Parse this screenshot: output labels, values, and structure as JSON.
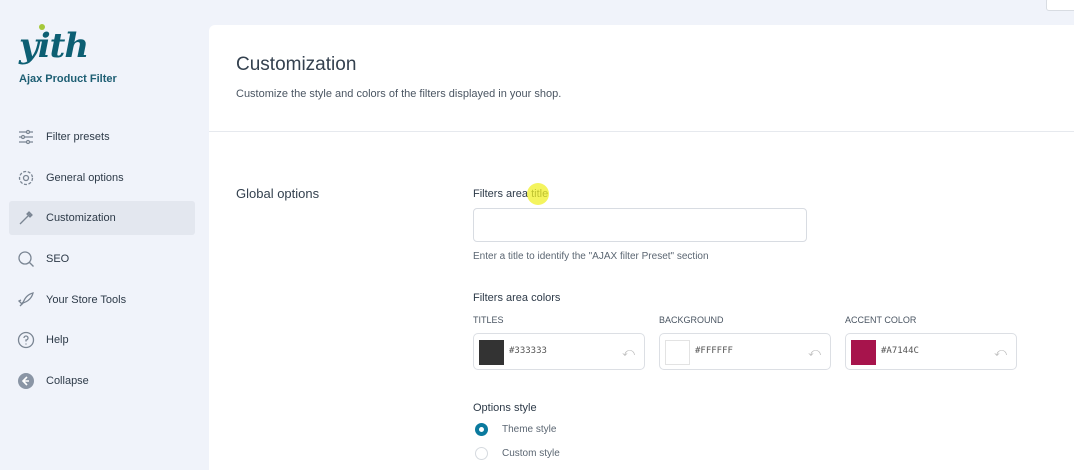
{
  "sidebar": {
    "logo": "yith",
    "product": "Ajax Product Filter",
    "items": [
      {
        "label": "Filter presets",
        "icon": "sliders-icon"
      },
      {
        "label": "General options",
        "icon": "gear-icon"
      },
      {
        "label": "Customization",
        "icon": "eyedropper-icon",
        "active": true
      },
      {
        "label": "SEO",
        "icon": "search-icon"
      },
      {
        "label": "Your Store Tools",
        "icon": "rocket-icon"
      },
      {
        "label": "Help",
        "icon": "help-icon"
      },
      {
        "label": "Collapse",
        "icon": "collapse-icon"
      }
    ]
  },
  "main": {
    "title": "Customization",
    "subtitle": "Customize the style and colors of the filters displayed in your shop.",
    "section": "Global options",
    "filters_title": {
      "label": "Filters area title",
      "value": "",
      "help": "Enter a title to identify the \"AJAX filter Preset\" section"
    },
    "colors": {
      "label": "Filters area colors",
      "items": [
        {
          "caption": "TITLES",
          "value": "#333333"
        },
        {
          "caption": "BACKGROUND",
          "value": "#FFFFFF"
        },
        {
          "caption": "ACCENT COLOR",
          "value": "#A7144C"
        }
      ]
    },
    "options_style": {
      "label": "Options style",
      "options": [
        {
          "label": "Theme style",
          "selected": true
        },
        {
          "label": "Custom style",
          "selected": false
        }
      ]
    }
  },
  "colors": {
    "accent": "#0b7a9e",
    "brand": "#0d5f73"
  }
}
